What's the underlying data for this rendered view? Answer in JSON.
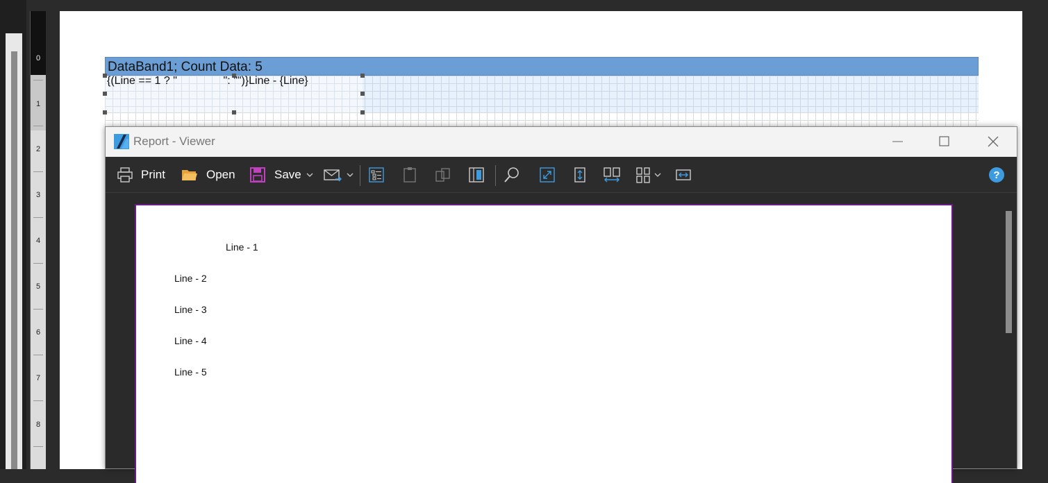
{
  "ruler": {
    "numbers": [
      "0",
      "1",
      "2",
      "3",
      "4",
      "5",
      "6",
      "7",
      "8"
    ]
  },
  "designer": {
    "band_header": "DataBand1; Count Data: 5",
    "text_expression": "{(Line == 1 ? \"               \": \"\")}Line - {Line}"
  },
  "viewer": {
    "title": "Report - Viewer",
    "toolbar": {
      "print_label": "Print",
      "open_label": "Open",
      "save_label": "Save"
    },
    "page_lines": [
      "Line - 1",
      "Line - 2",
      "Line - 3",
      "Line - 4",
      "Line - 5"
    ]
  },
  "colors": {
    "band_header": "#6b9ed4",
    "page_border": "#6a1a8a",
    "accent_blue": "#3d9be0",
    "save_purple": "#c040c0",
    "folder_orange": "#e8a33c"
  }
}
